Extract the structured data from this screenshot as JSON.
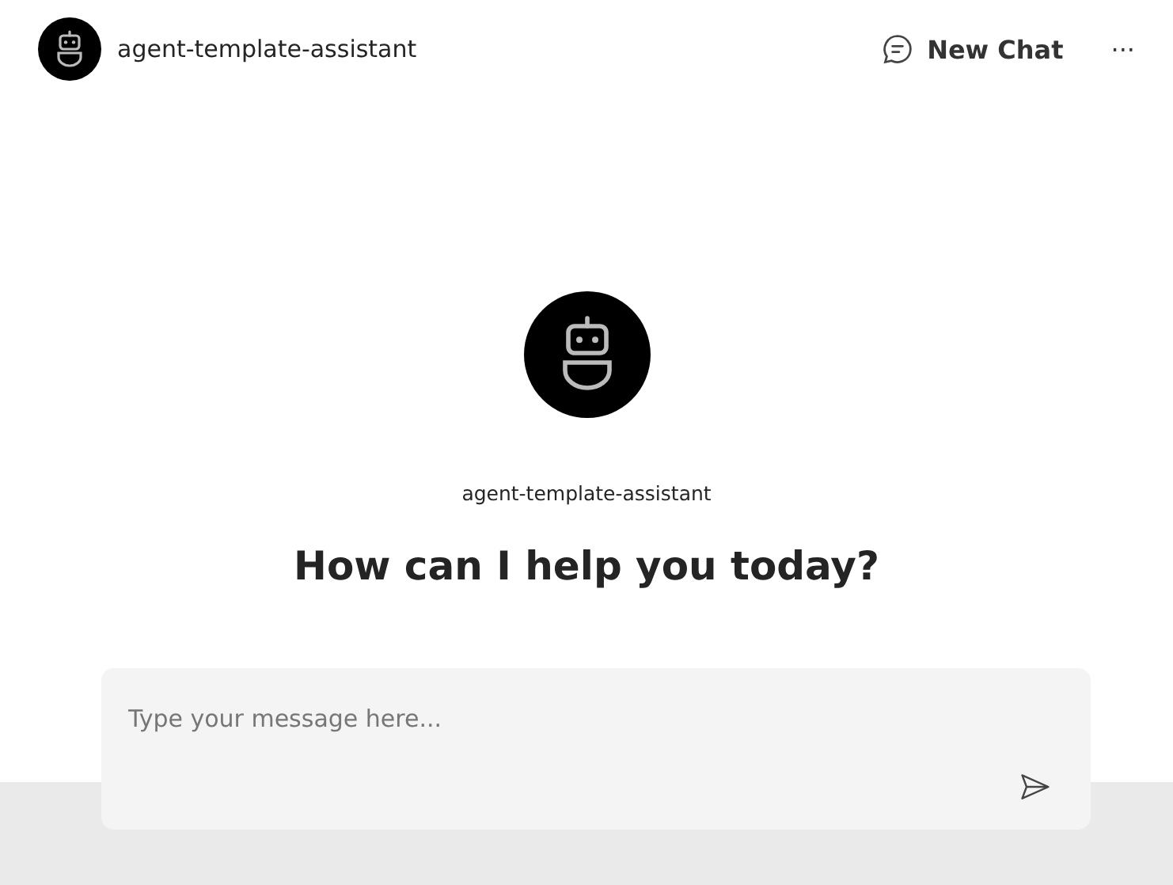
{
  "header": {
    "agent_name": "agent-template-assistant",
    "new_chat_button": "New Chat",
    "more_button": "···"
  },
  "welcome": {
    "agent_name": "agent-template-assistant",
    "heading": "How can I help you today?"
  },
  "composer": {
    "placeholder": "Type your message here..."
  }
}
